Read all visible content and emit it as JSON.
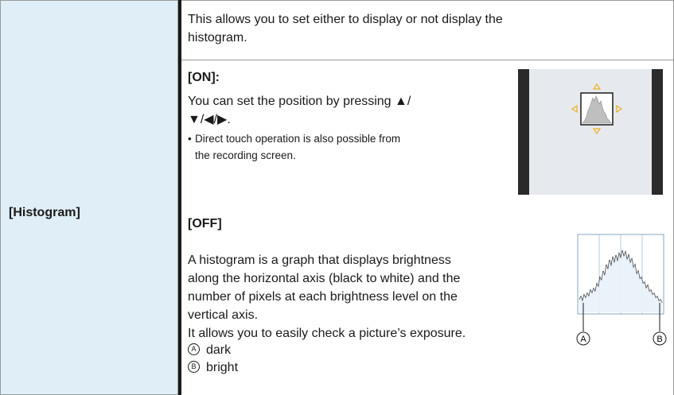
{
  "setting": {
    "name": "[Histogram]"
  },
  "intro": {
    "line1": "This allows you to set either to display or not display the",
    "line2": "histogram."
  },
  "on_section": {
    "heading": "[ON]:",
    "line1": "You can set the position by pressing ▲/",
    "line2": "▼/◀/▶.",
    "bullet": "•",
    "note1": "Direct touch operation is also possible from",
    "note2": "the recording screen."
  },
  "off_section": {
    "heading": "[OFF]",
    "line1": "A histogram is a graph that displays brightness",
    "line2": "along the horizontal axis (black to white) and the",
    "line3": "number of pixels at each brightness level on the",
    "line4": "vertical axis.",
    "line5": "It allows you to easily check a picture’s exposure.",
    "legend": [
      {
        "marker": "A",
        "label": "dark"
      },
      {
        "marker": "B",
        "label": "bright"
      }
    ]
  },
  "diagram_markers": {
    "left": "A",
    "right": "B"
  },
  "colors": {
    "left_cell_bg": "#dfeef7",
    "screen_bg": "#e6e9ee",
    "arrow": "#f0b020",
    "grid_line": "#9fc3dc"
  }
}
